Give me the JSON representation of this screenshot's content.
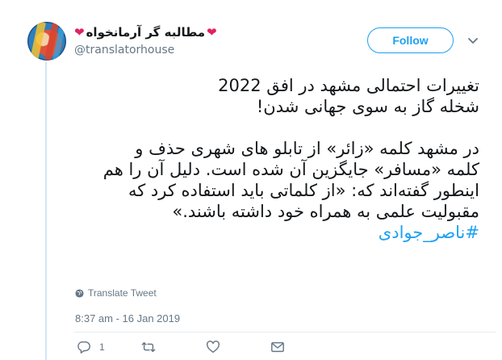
{
  "header": {
    "display_name": "مطالبه گر آرمانخواه",
    "heart_left": "❤",
    "heart_right": "❤",
    "handle": "@translatorhouse",
    "follow_label": "Follow"
  },
  "tweet": {
    "line1": "تغییرات احتمالی مشهد در افق 2022",
    "line2": "شخله گاز به سوی جهانی شدن!",
    "line3": "در مشهد کلمه «زائر» از تابلو های شهری حذف و",
    "line4": "کلمه «مسافر» جایگزین آن شده است. دلیل آن را هم",
    "line5": "اینطور گفته‌اند که: «از کلماتی باید استفاده کرد که",
    "line6": "مقبولیت علمی به همراه خود داشته باشند.»",
    "hashtag": "#ناصر_جوادی"
  },
  "translate_label": "Translate Tweet",
  "timestamp": "8:37 am - 16 Jan 2019",
  "actions": {
    "reply_count": "1"
  },
  "colors": {
    "accent": "#1da1f2",
    "muted": "#657786",
    "heart": "#e0245e"
  }
}
